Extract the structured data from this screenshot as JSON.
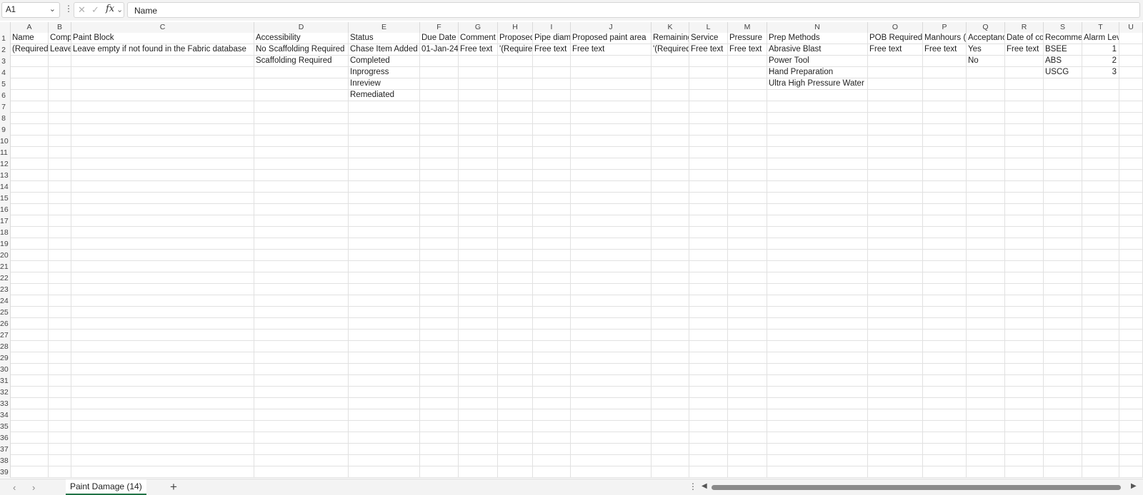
{
  "formula_bar": {
    "name_box": "A1",
    "cancel_glyph": "✕",
    "enter_glyph": "✓",
    "fx_glyph": "fx",
    "content": "Name"
  },
  "columns": [
    "A",
    "B",
    "C",
    "D",
    "E",
    "F",
    "G",
    "H",
    "I",
    "J",
    "K",
    "L",
    "M",
    "N",
    "O",
    "P",
    "Q",
    "R",
    "S",
    "T",
    "U"
  ],
  "row_numbers": [
    "1",
    "2",
    "3",
    "4",
    "5",
    "6",
    "7",
    "8",
    "9",
    "10",
    "11",
    "12",
    "13",
    "14",
    "15",
    "16",
    "17",
    "18",
    "19",
    "20",
    "21",
    "22",
    "23",
    "24",
    "25",
    "26",
    "27",
    "28",
    "29",
    "30",
    "31",
    "32",
    "33",
    "34",
    "35",
    "36",
    "37",
    "38",
    "39"
  ],
  "rows": [
    [
      "Name",
      "Comp",
      "Paint Block",
      "Accessibility",
      "Status",
      "Due Date",
      "Comment",
      "Proposed",
      "Pipe diam",
      "Proposed paint area",
      "Remaining",
      "Service",
      "Pressure",
      "Prep Methods",
      "POB Required",
      "Manhours (",
      "Acceptanc",
      "Date of co",
      "Recomme",
      "Alarm Level",
      ""
    ],
    [
      "(Required",
      "Leave",
      "Leave empty if not found in the Fabric database",
      "No Scaffolding Required",
      "Chase Item Added",
      "01-Jan-24",
      "Free text",
      "'(Require",
      "Free text",
      "Free text",
      "'(Required",
      "Free text",
      "Free text",
      "Abrasive Blast",
      "Free text",
      "Free text",
      "Yes",
      "Free text",
      "BSEE",
      "1",
      ""
    ],
    [
      "",
      "",
      "",
      "Scaffolding Required",
      "Completed",
      "",
      "",
      "",
      "",
      "",
      "",
      "",
      "",
      "Power Tool",
      "",
      "",
      "No",
      "",
      "ABS",
      "2",
      ""
    ],
    [
      "",
      "",
      "",
      "",
      "Inprogress",
      "",
      "",
      "",
      "",
      "",
      "",
      "",
      "",
      "Hand Preparation",
      "",
      "",
      "",
      "",
      "USCG",
      "3",
      ""
    ],
    [
      "",
      "",
      "",
      "",
      "Inreview",
      "",
      "",
      "",
      "",
      "",
      "",
      "",
      "",
      "Ultra High Pressure Water",
      "",
      "",
      "",
      "",
      "",
      "",
      ""
    ],
    [
      "",
      "",
      "",
      "",
      "Remediated",
      "",
      "",
      "",
      "",
      "",
      "",
      "",
      "",
      "",
      "",
      "",
      "",
      "",
      "",
      "",
      ""
    ]
  ],
  "sheet_tabs": {
    "nav_prev": "‹",
    "nav_next": "›",
    "active": "Paint Damage (14)",
    "add": "+"
  },
  "icons": {
    "name_box_dropdown": "chevron-down-icon",
    "more": "more-vertical-icon",
    "cancel": "cancel-x-icon",
    "enter": "check-icon",
    "function": "fx-icon"
  }
}
